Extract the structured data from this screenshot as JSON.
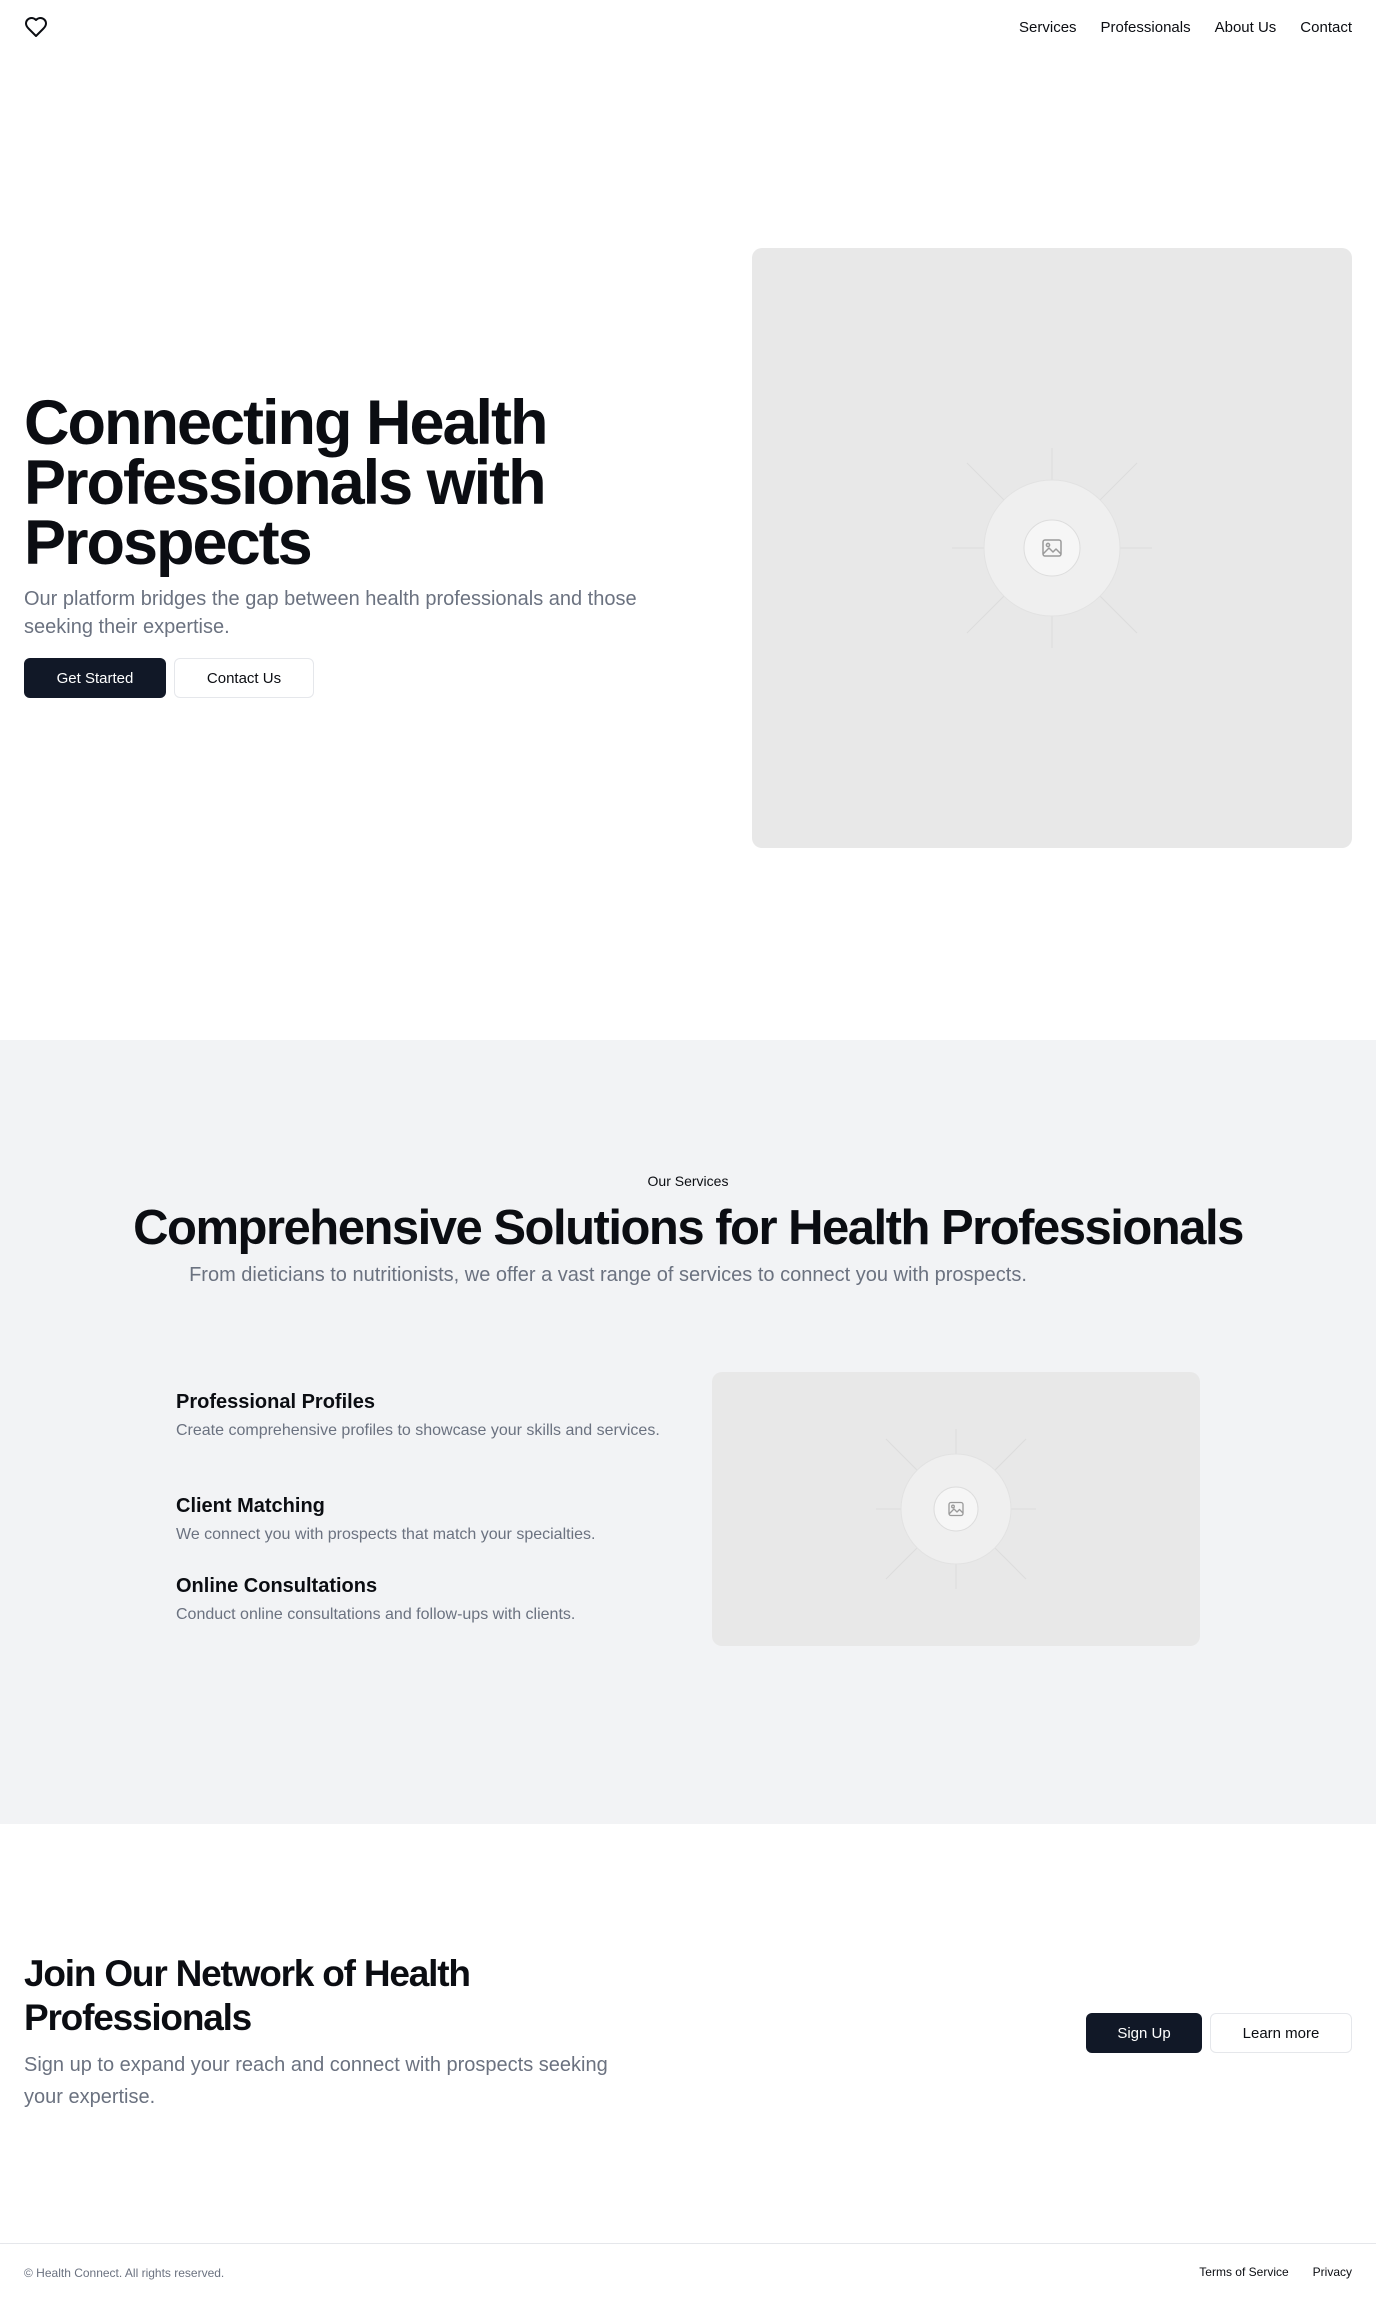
{
  "header": {
    "logo_icon": "heart-icon",
    "nav": [
      "Services",
      "Professionals",
      "About Us",
      "Contact"
    ]
  },
  "hero": {
    "title": "Connecting Health Professionals with Prospects",
    "subtitle": "Our platform bridges the gap between health professionals and those seeking their expertise.",
    "primary_button": "Get Started",
    "secondary_button": "Contact Us",
    "image_icon": "image-placeholder-icon"
  },
  "services": {
    "eyebrow": "Our Services",
    "title": "Comprehensive Solutions for Health Professionals",
    "subtitle": "From dieticians to nutritionists, we offer a vast range of services to connect you with prospects.",
    "features": [
      {
        "title": "Professional Profiles",
        "description": "Create comprehensive profiles to showcase your skills and services."
      },
      {
        "title": "Client Matching",
        "description": "We connect you with prospects that match your specialties."
      },
      {
        "title": "Online Consultations",
        "description": "Conduct online consultations and follow-ups with clients."
      }
    ],
    "image_icon": "image-placeholder-icon"
  },
  "cta": {
    "title": "Join Our Network of Health Professionals",
    "subtitle": "Sign up to expand your reach and connect with prospects seeking your expertise.",
    "primary_button": "Sign Up",
    "secondary_button": "Learn more"
  },
  "footer": {
    "copyright": "© Health Connect. All rights reserved.",
    "links": [
      "Terms of Service",
      "Privacy"
    ]
  },
  "colors": {
    "primary": "#111827",
    "muted_text": "#6b7280",
    "section_bg": "#f2f3f5",
    "placeholder_bg": "#e8e8e8"
  }
}
